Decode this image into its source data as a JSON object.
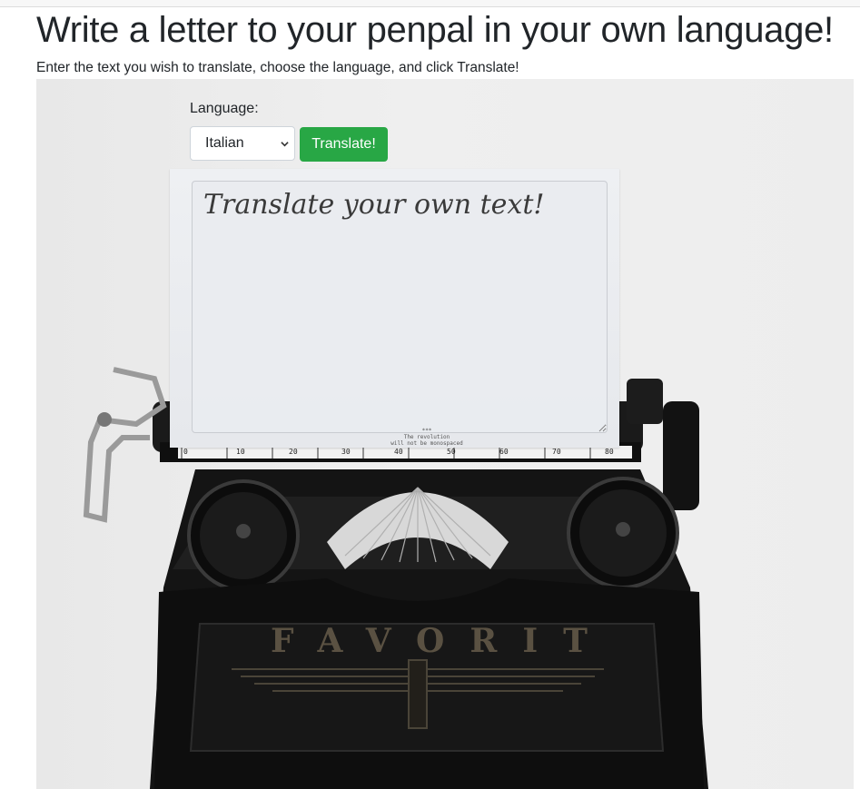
{
  "page": {
    "heading": "Write a letter to your penpal in your own language!",
    "instructions": "Enter the text you wish to translate, choose the language, and click Translate!"
  },
  "form": {
    "language_label": "Language:",
    "language_selected": "Italian",
    "translate_label": "Translate!",
    "textarea_placeholder": "Translate your own text!"
  },
  "hero": {
    "paper_print": "***\nThe revolution\nwill not be monospaced",
    "brand": "FAVORIT",
    "scale_numbers": [
      "0",
      "10",
      "20",
      "30",
      "40",
      "50",
      "60",
      "70",
      "80"
    ]
  },
  "colors": {
    "button": "#28a745",
    "text": "#212529",
    "typewriter": "#141414"
  }
}
